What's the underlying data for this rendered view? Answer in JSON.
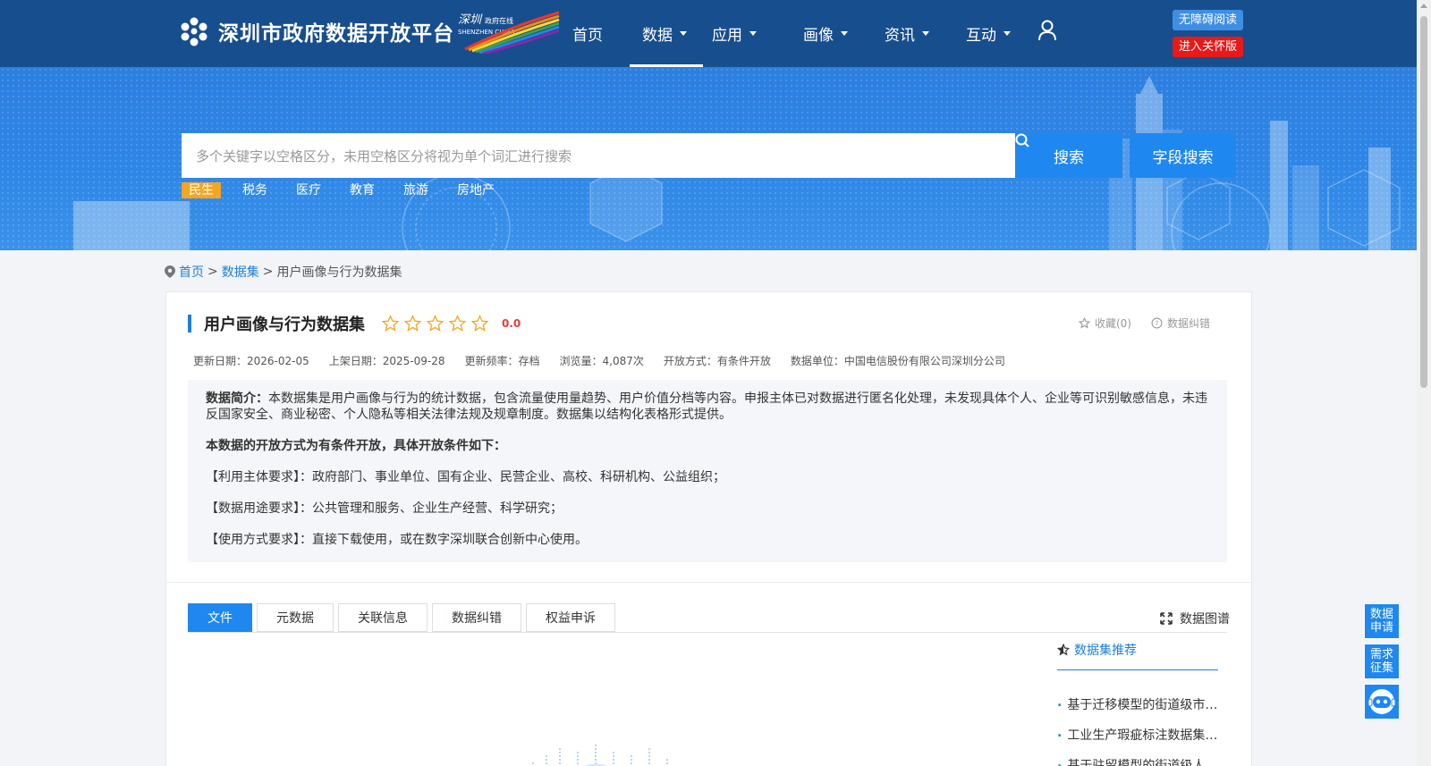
{
  "header": {
    "logo_title": "深圳市政府数据开放平台",
    "nav": [
      {
        "label": "首页",
        "has_dropdown": false,
        "active": false
      },
      {
        "label": "数据",
        "has_dropdown": true,
        "active": true
      },
      {
        "label": "应用",
        "has_dropdown": true,
        "active": false
      },
      {
        "label": "画像",
        "has_dropdown": true,
        "active": false
      },
      {
        "label": "资讯",
        "has_dropdown": true,
        "active": false
      },
      {
        "label": "互动",
        "has_dropdown": true,
        "active": false
      }
    ],
    "accessibility_label": "无障碍阅读",
    "care_mode_label": "进入关怀版"
  },
  "search": {
    "placeholder": "多个关键字以空格区分，未用空格区分将视为单个词汇进行搜索",
    "search_button": "搜索",
    "field_search_button": "字段搜索",
    "hot_tags": [
      "民生",
      "税务",
      "医疗",
      "教育",
      "旅游",
      "房地产"
    ]
  },
  "breadcrumb": {
    "home": "首页",
    "sep": ">",
    "datasets": "数据集",
    "current": "用户画像与行为数据集"
  },
  "dataset": {
    "title": "用户画像与行为数据集",
    "rating": "0.0",
    "star_count": 5,
    "favorite_label": "收藏(0)",
    "correction_label": "数据纠错",
    "meta": {
      "updated": "更新日期：2026-02-05",
      "published": "上架日期：2025-09-28",
      "frequency": "更新频率：存档",
      "views": "浏览量：4,087次",
      "open_mode": "开放方式：有条件开放",
      "source": "数据单位：中国电信股份有限公司深圳分公司"
    },
    "description_label": "数据简介：",
    "description": "本数据集是用户画像与行为的统计数据，包含流量使用量趋势、用户价值分档等内容。申报主体已对数据进行匿名化处理，未发现具体个人、企业等可识别敏感信息，未违反国家安全、商业秘密、个人隐私等相关法律法规及规章制度。数据集以结构化表格形式提供。",
    "conditions_heading": "本数据的开放方式为有条件开放，具体开放条件如下：",
    "conditions": [
      "【利用主体要求】：政府部门、事业单位、国有企业、民营企业、高校、科研机构、公益组织；",
      "【数据用途要求】：公共管理和服务、企业生产经营、科学研究；",
      "【使用方式要求】：直接下载使用，或在数字深圳联合创新中心使用。"
    ]
  },
  "tabs": [
    "文件",
    "元数据",
    "关联信息",
    "数据纠错",
    "权益申诉"
  ],
  "graph_link": "数据图谱",
  "recommend": {
    "title": "数据集推荐",
    "items": [
      "基于迁移模型的街道级市民出行数据集",
      "工业生产瑕疵标注数据集合集",
      "基于驻留模型的街道级人口数据集"
    ]
  },
  "float": {
    "apply": "数据申请",
    "demand": "需求征集"
  },
  "colors": {
    "header_bg": "#174e8e",
    "accent": "#1e88f0",
    "care_red": "#e81919",
    "tag_active": "#f5a623",
    "rating_red": "#e83b3b"
  }
}
